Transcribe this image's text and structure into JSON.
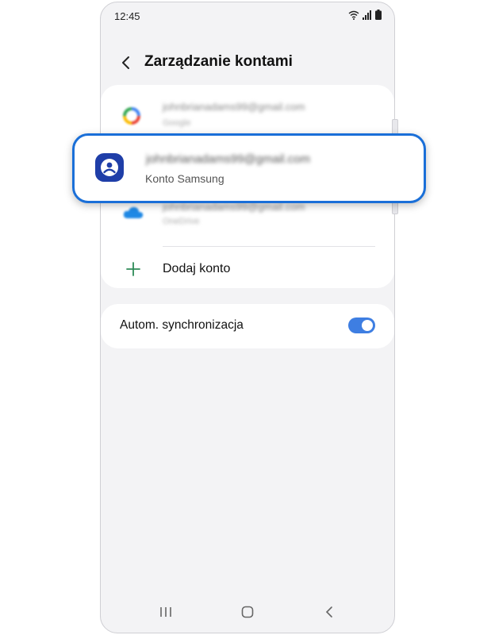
{
  "status_bar": {
    "time": "12:45",
    "icons": [
      "wifi-icon",
      "signal-icon",
      "battery-icon"
    ]
  },
  "header": {
    "title": "Zarządzanie kontami",
    "back_icon": "chevron-left-icon"
  },
  "accounts": [
    {
      "email": "johnbrianadams99@gmail.com",
      "type": "Google",
      "icon": "google-icon"
    },
    {
      "email": "johnbrianadams99@gmail.com",
      "type": "Konto Samsung",
      "icon": "samsung-account-icon",
      "highlighted": true
    },
    {
      "email": "johnbrianadams99@gmail.com",
      "type": "OneDrive",
      "icon": "onedrive-icon"
    }
  ],
  "add_account": {
    "label": "Dodaj konto",
    "icon": "plus-icon"
  },
  "sync": {
    "label": "Autom. synchronizacja",
    "enabled": true
  },
  "nav": {
    "recents": "recents-icon",
    "home": "home-icon",
    "back": "back-icon"
  },
  "colors": {
    "accent": "#3e7ee2",
    "highlight_border": "#1a6fd8",
    "samsung_icon_bg": "#1f3ea8",
    "add_icon": "#2e8b57"
  }
}
